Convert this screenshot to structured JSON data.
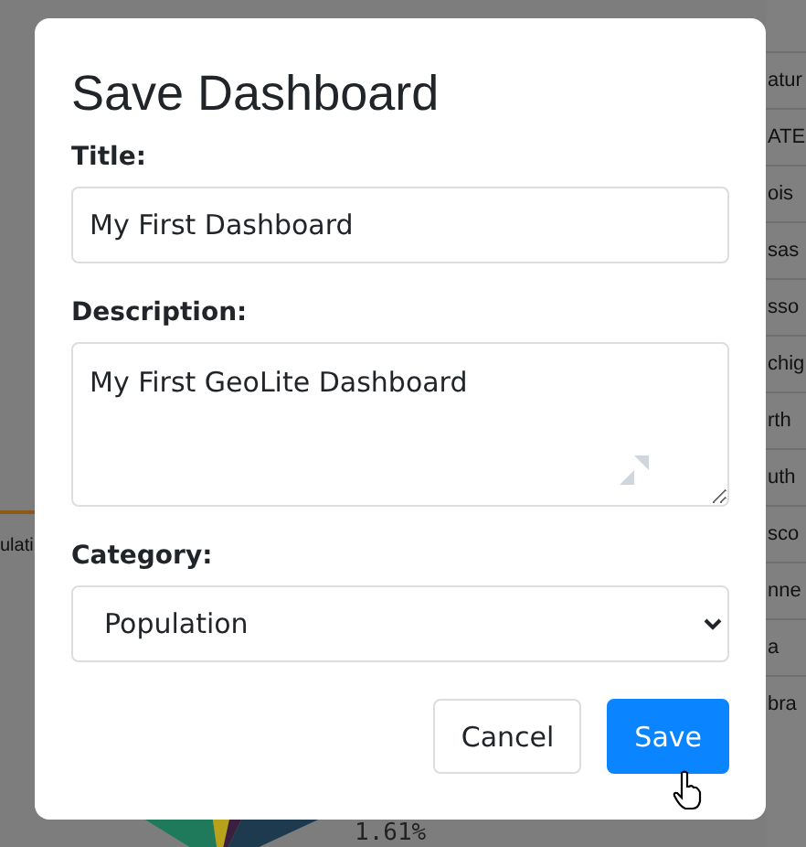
{
  "background": {
    "table_cells": [
      "atur",
      "ATE",
      "ois",
      "sas",
      "sso",
      "chig",
      "rth",
      "uth",
      "sco",
      "nne",
      "a",
      "bra"
    ],
    "tab_label": "ulati",
    "chart_label": "1.61%"
  },
  "dialog": {
    "title": "Save Dashboard",
    "fields": [
      {
        "kind": "text",
        "label": "Title:",
        "value": "My First Dashboard"
      },
      {
        "kind": "textarea",
        "label": "Description:",
        "value": "My First GeoLite Dashboard"
      },
      {
        "kind": "select",
        "label": "Category:",
        "value": "Population"
      }
    ],
    "buttons": [
      {
        "kind": "secondary",
        "label": "Cancel"
      },
      {
        "kind": "primary",
        "label": "Save"
      }
    ]
  }
}
